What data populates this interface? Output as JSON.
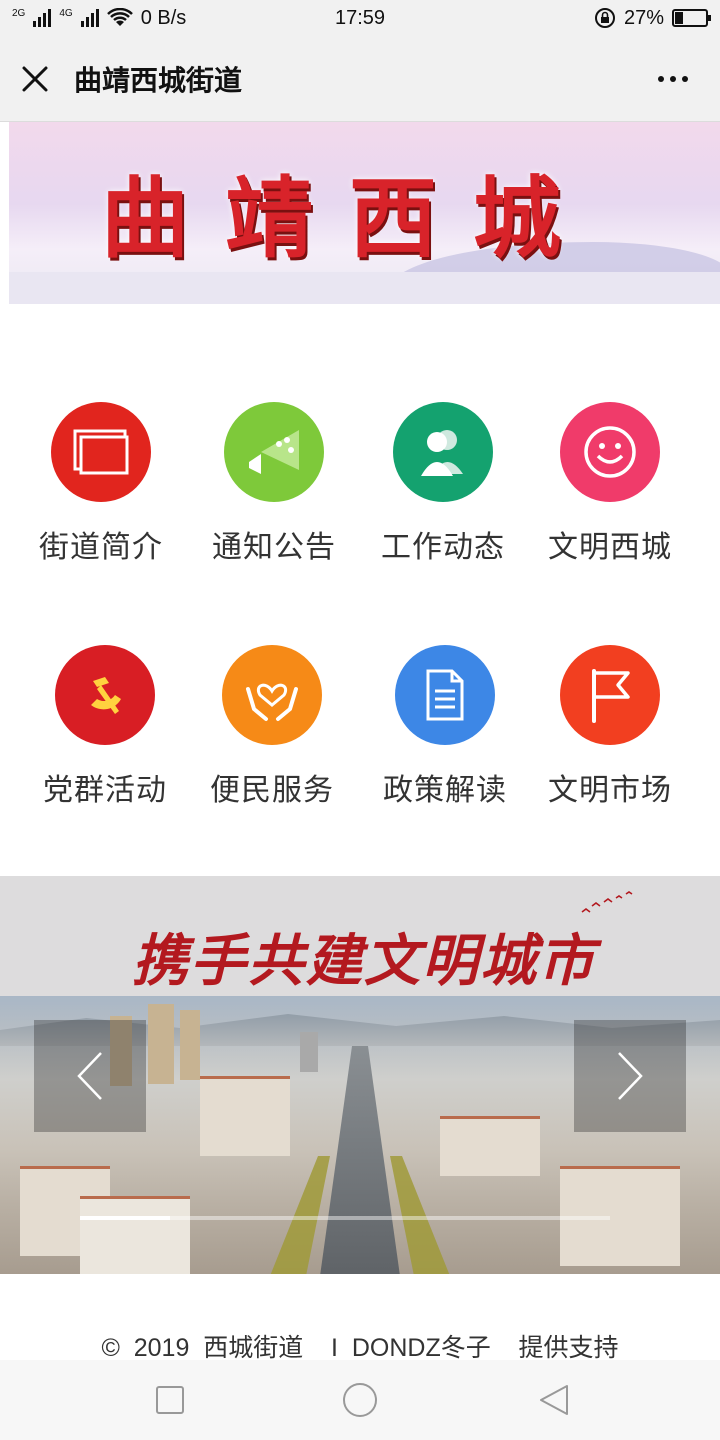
{
  "status_bar": {
    "network_2g": "2G",
    "network_4g": "4G",
    "speed": "0 B/s",
    "time": "17:59",
    "battery": "27%",
    "battery_level": 0.27
  },
  "title_bar": {
    "title": "曲靖西城街道",
    "close_icon": "close-icon",
    "more_icon": "more-icon"
  },
  "banner": {
    "text": "曲靖西城"
  },
  "menu": {
    "items": [
      {
        "label": "街道简介",
        "icon": "slides-icon",
        "color": "#e1251e"
      },
      {
        "label": "通知公告",
        "icon": "megaphone-icon",
        "color": "#7ec93a"
      },
      {
        "label": "工作动态",
        "icon": "people-icon",
        "color": "#14a26f"
      },
      {
        "label": "文明西城",
        "icon": "smile-icon",
        "color": "#f03b6a"
      },
      {
        "label": "党群活动",
        "icon": "party-emblem-icon",
        "color": "#d81e24"
      },
      {
        "label": "便民服务",
        "icon": "heart-hands-icon",
        "color": "#f68a17"
      },
      {
        "label": "政策解读",
        "icon": "document-icon",
        "color": "#3d87e6"
      },
      {
        "label": "文明市场",
        "icon": "flag-icon",
        "color": "#f23f20"
      }
    ]
  },
  "city_banner": {
    "slogan": "携手共建文明城市",
    "prev_icon": "chevron-left-icon",
    "next_icon": "chevron-right-icon"
  },
  "footer": {
    "text": "©  2019  西城街道    I  DONDZ冬子    提供支持"
  },
  "nav_bar": {
    "square_icon": "recent-apps-icon",
    "circle_icon": "home-icon",
    "triangle_icon": "back-icon"
  }
}
